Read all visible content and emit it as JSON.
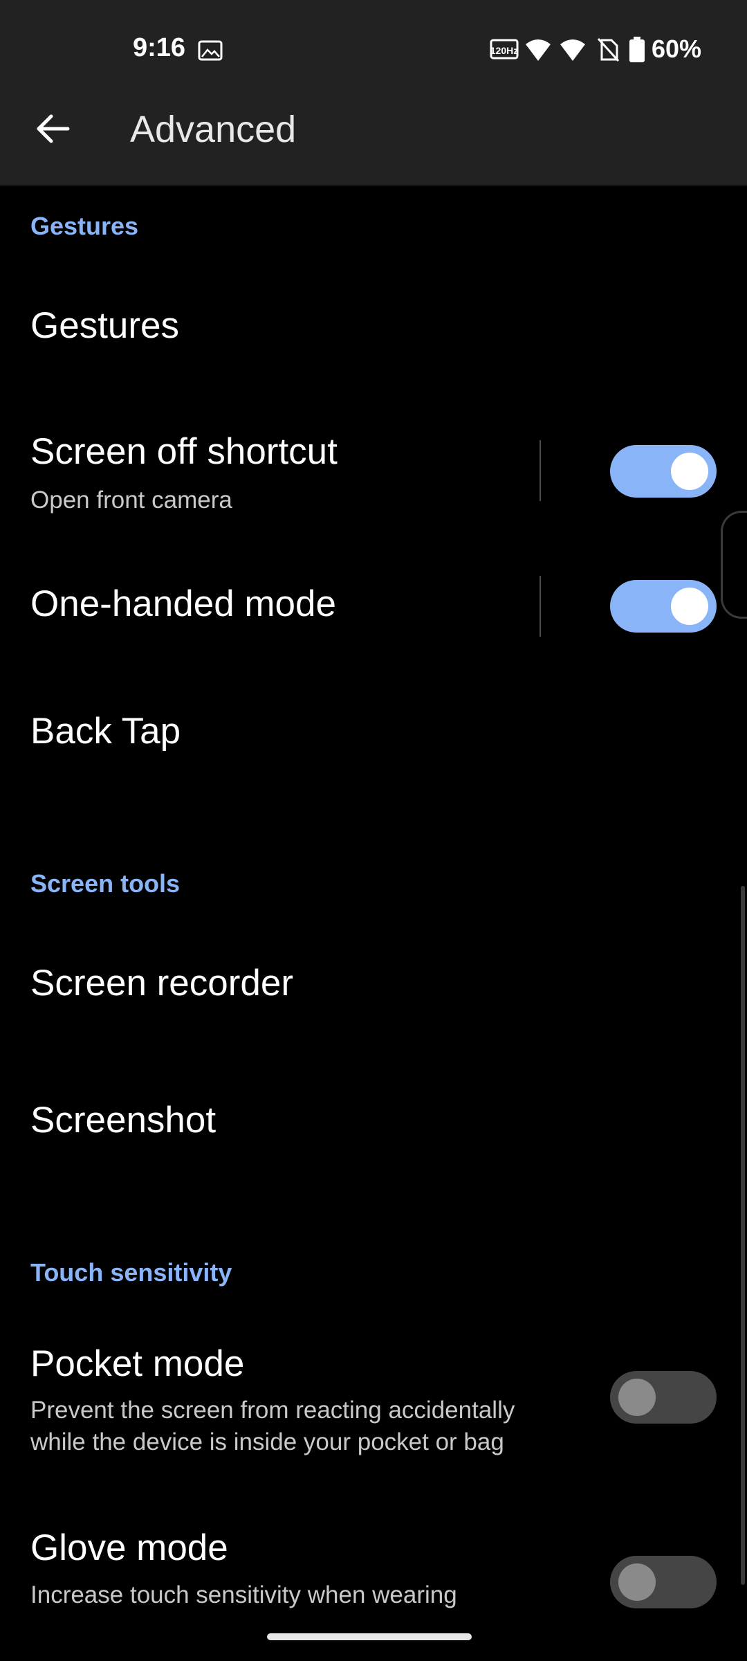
{
  "status_bar": {
    "time": "9:16",
    "battery_percent": "60%",
    "refresh_rate_label": "120Hz",
    "icons": [
      "image-icon",
      "refresh-rate-icon",
      "wifi-icon",
      "signal-icon",
      "no-sim-icon",
      "battery-icon"
    ]
  },
  "app_bar": {
    "title": "Advanced",
    "back_icon": "arrow-left-icon"
  },
  "colors": {
    "accent": "#8ab4f8",
    "background": "#000000",
    "bar_background": "#222222",
    "section_header": "#8ab4f8"
  },
  "sections": [
    {
      "header": "Gestures",
      "items": [
        {
          "title": "Gestures"
        },
        {
          "title": "Screen off shortcut",
          "subtitle": "Open front camera",
          "toggle": true
        },
        {
          "title": "One-handed mode",
          "toggle": true
        },
        {
          "title": "Back Tap"
        }
      ]
    },
    {
      "header": "Screen tools",
      "items": [
        {
          "title": "Screen recorder"
        },
        {
          "title": "Screenshot"
        }
      ]
    },
    {
      "header": "Touch sensitivity",
      "items": [
        {
          "title": "Pocket mode",
          "subtitle_lines": [
            "Prevent the screen from reacting accidentally",
            "while the device is inside your pocket or bag"
          ],
          "toggle": false
        },
        {
          "title": "Glove mode",
          "subtitle": "Increase touch sensitivity when wearing",
          "toggle": false
        }
      ]
    }
  ]
}
